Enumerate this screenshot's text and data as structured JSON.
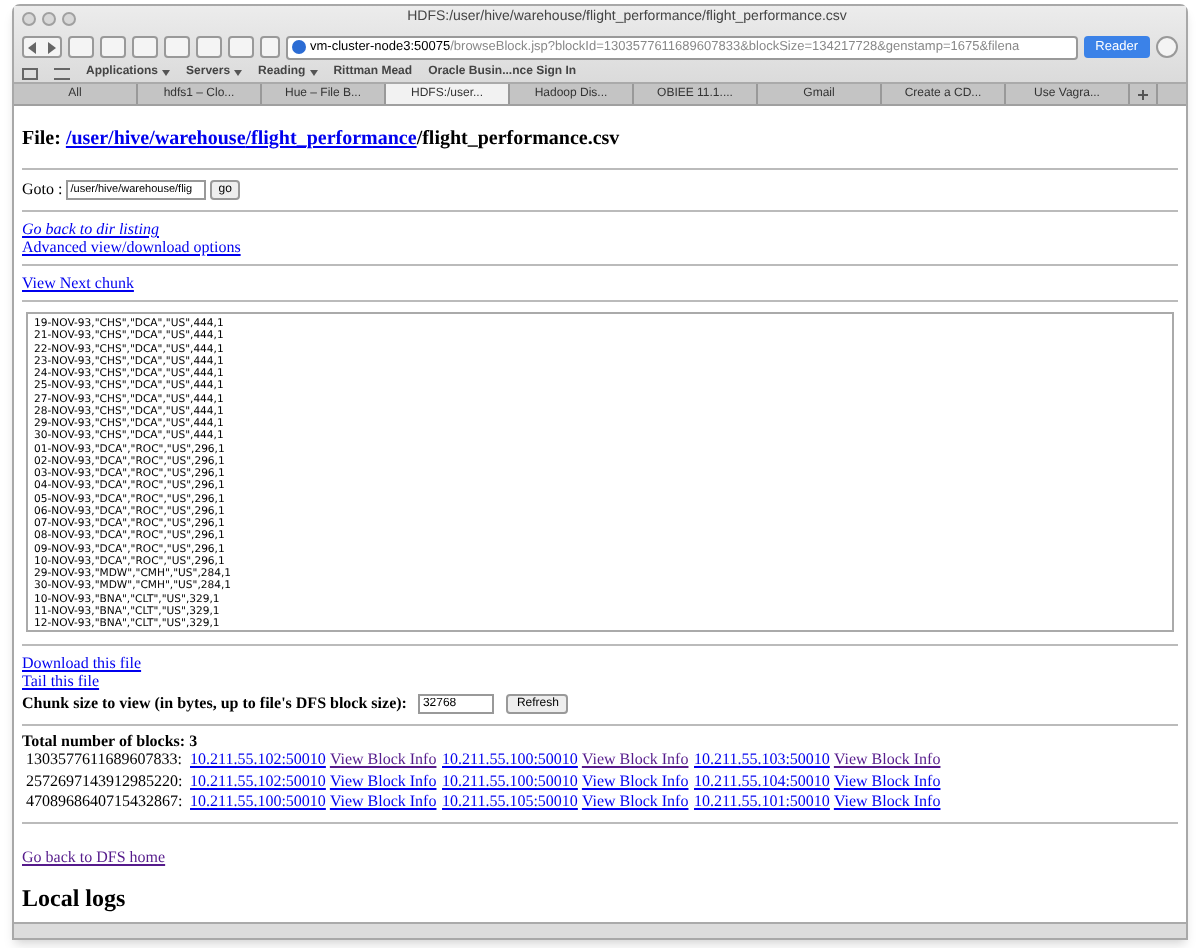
{
  "window": {
    "title": "HDFS:/user/hive/warehouse/flight_performance/flight_performance.csv"
  },
  "address_bar": {
    "host": "vm-cluster-node3:50075",
    "path": "/browseBlock.jsp?blockId=1303577611689607833&blockSize=134217728&genstamp=1675&filena",
    "reader": "Reader"
  },
  "bookmarks": [
    {
      "label": "Applications",
      "menu": true
    },
    {
      "label": "Servers",
      "menu": true
    },
    {
      "label": "Reading",
      "menu": true
    },
    {
      "label": "Rittman Mead",
      "menu": false
    },
    {
      "label": "Oracle Busin...nce Sign In",
      "menu": false
    }
  ],
  "tabs": [
    {
      "label": "All",
      "selected": false
    },
    {
      "label": "hdfs1 – Clo...",
      "selected": false
    },
    {
      "label": "Hue – File B...",
      "selected": false
    },
    {
      "label": "HDFS:/user...",
      "selected": true
    },
    {
      "label": "Hadoop Dis...",
      "selected": false
    },
    {
      "label": "OBIEE 11.1....",
      "selected": false
    },
    {
      "label": "Gmail",
      "selected": false
    },
    {
      "label": "Create a CD...",
      "selected": false
    },
    {
      "label": "Use Vagra...",
      "selected": false
    }
  ],
  "file_heading": {
    "label": "File:",
    "path_links": [
      "/user",
      "/hive",
      "/warehouse",
      "/flight_performance"
    ],
    "file_name": "/flight_performance.csv"
  },
  "goto": {
    "label": "Goto :",
    "value": "/user/hive/warehouse/flig",
    "button": "go"
  },
  "links_top": [
    {
      "label": "Go back to dir listing",
      "italic": true
    },
    {
      "label": "Advanced view/download options",
      "italic": false
    }
  ],
  "next_chunk": "View Next chunk",
  "file_content": [
    "19-NOV-93,\"CHS\",\"DCA\",\"US\",444,1",
    "21-NOV-93,\"CHS\",\"DCA\",\"US\",444,1",
    "22-NOV-93,\"CHS\",\"DCA\",\"US\",444,1",
    "23-NOV-93,\"CHS\",\"DCA\",\"US\",444,1",
    "24-NOV-93,\"CHS\",\"DCA\",\"US\",444,1",
    "25-NOV-93,\"CHS\",\"DCA\",\"US\",444,1",
    "27-NOV-93,\"CHS\",\"DCA\",\"US\",444,1",
    "28-NOV-93,\"CHS\",\"DCA\",\"US\",444,1",
    "29-NOV-93,\"CHS\",\"DCA\",\"US\",444,1",
    "30-NOV-93,\"CHS\",\"DCA\",\"US\",444,1",
    "01-NOV-93,\"DCA\",\"ROC\",\"US\",296,1",
    "02-NOV-93,\"DCA\",\"ROC\",\"US\",296,1",
    "03-NOV-93,\"DCA\",\"ROC\",\"US\",296,1",
    "04-NOV-93,\"DCA\",\"ROC\",\"US\",296,1",
    "05-NOV-93,\"DCA\",\"ROC\",\"US\",296,1",
    "06-NOV-93,\"DCA\",\"ROC\",\"US\",296,1",
    "07-NOV-93,\"DCA\",\"ROC\",\"US\",296,1",
    "08-NOV-93,\"DCA\",\"ROC\",\"US\",296,1",
    "09-NOV-93,\"DCA\",\"ROC\",\"US\",296,1",
    "10-NOV-93,\"DCA\",\"ROC\",\"US\",296,1",
    "29-NOV-93,\"MDW\",\"CMH\",\"US\",284,1",
    "30-NOV-93,\"MDW\",\"CMH\",\"US\",284,1",
    "10-NOV-93,\"BNA\",\"CLT\",\"US\",329,1",
    "11-NOV-93,\"BNA\",\"CLT\",\"US\",329,1",
    "12-NOV-93,\"BNA\",\"CLT\",\"US\",329,1"
  ],
  "links_mid": [
    "Download this file",
    "Tail this file"
  ],
  "chunk_size": {
    "label": "Chunk size to view (in bytes, up to file's DFS block size):",
    "value": "32768",
    "button": "Refresh"
  },
  "blocks": {
    "total": "Total number of blocks: 3",
    "rows": [
      {
        "id": "1303577611689607833:",
        "locations": [
          {
            "host": "10.211.55.102:50010",
            "info": "View Block Info",
            "visited": true
          },
          {
            "host": "10.211.55.100:50010",
            "info": "View Block Info",
            "visited": true
          },
          {
            "host": "10.211.55.103:50010",
            "info": "View Block Info",
            "visited": true
          }
        ]
      },
      {
        "id": "2572697143912985220:",
        "locations": [
          {
            "host": "10.211.55.102:50010",
            "info": "View Block Info",
            "visited": false
          },
          {
            "host": "10.211.55.100:50010",
            "info": "View Block Info",
            "visited": false
          },
          {
            "host": "10.211.55.104:50010",
            "info": "View Block Info",
            "visited": false
          }
        ]
      },
      {
        "id": "4708968640715432867:",
        "locations": [
          {
            "host": "10.211.55.100:50010",
            "info": "View Block Info",
            "visited": false
          },
          {
            "host": "10.211.55.105:50010",
            "info": "View Block Info",
            "visited": false
          },
          {
            "host": "10.211.55.101:50010",
            "info": "View Block Info",
            "visited": false
          }
        ]
      }
    ]
  },
  "dfs_home": {
    "label": "Go back to DFS home",
    "visited": true
  },
  "local_logs": "Local logs"
}
